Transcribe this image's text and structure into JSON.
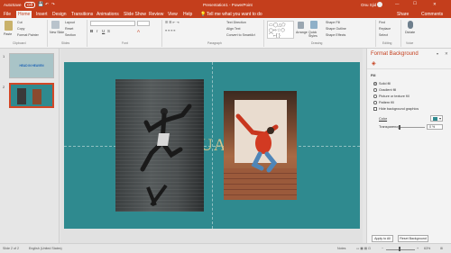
{
  "titlebar": {
    "autosave": "AutoSave",
    "autosave_state": "Off",
    "doc_title": "Presentation1 - PowerPoint",
    "user": "Onu Sjid"
  },
  "tabs": [
    "File",
    "Home",
    "Insert",
    "Design",
    "Transitions",
    "Animations",
    "Slide Show",
    "Review",
    "View",
    "Help"
  ],
  "tell_me": "Tell me what you want to do",
  "share_label": "Share",
  "comments_label": "Comments",
  "ribbon": {
    "paste": "Paste",
    "clipboard_items": [
      "Cut",
      "Copy",
      "Format Painter"
    ],
    "new_slide": "New Slide",
    "slides_items": [
      "Layout",
      "Reset",
      "Section"
    ],
    "text_direction": "Text Direction",
    "align_text": "Align Text",
    "convert_smartart": "Convert to SmartArt",
    "arrange": "Arrange",
    "quick_styles": "Quick Styles",
    "shape_fill": "Shape Fill",
    "shape_outline": "Shape Outline",
    "shape_effects": "Shape Effects",
    "find": "Find",
    "replace": "Replace",
    "select": "Select",
    "dictate": "Dictate",
    "groups": [
      "Clipboard",
      "Slides",
      "Font",
      "Paragraph",
      "Drawing",
      "Editing",
      "Voice"
    ]
  },
  "slides": [
    {
      "number": "1",
      "title": "HEAD IN HEAVEN"
    },
    {
      "number": "2",
      "title": ""
    }
  ],
  "slide_title_partial": "UA",
  "pane": {
    "title": "Format Background",
    "section": "Fill",
    "options": [
      "Solid fill",
      "Gradient fill",
      "Picture or texture fill",
      "Pattern fill",
      "Hide background graphics"
    ],
    "selected_option": "Solid fill",
    "color_label": "Color",
    "transparency_label": "Transparency",
    "transparency_value": "0 %",
    "apply_all": "Apply to All",
    "reset": "Reset Background"
  },
  "status": {
    "slide": "Slide 2 of 2",
    "language": "English (United States)",
    "notes": "Notes",
    "zoom": "63%"
  },
  "colors": {
    "accent": "#c43e1c",
    "slide_bg": "#2f8a8f"
  }
}
